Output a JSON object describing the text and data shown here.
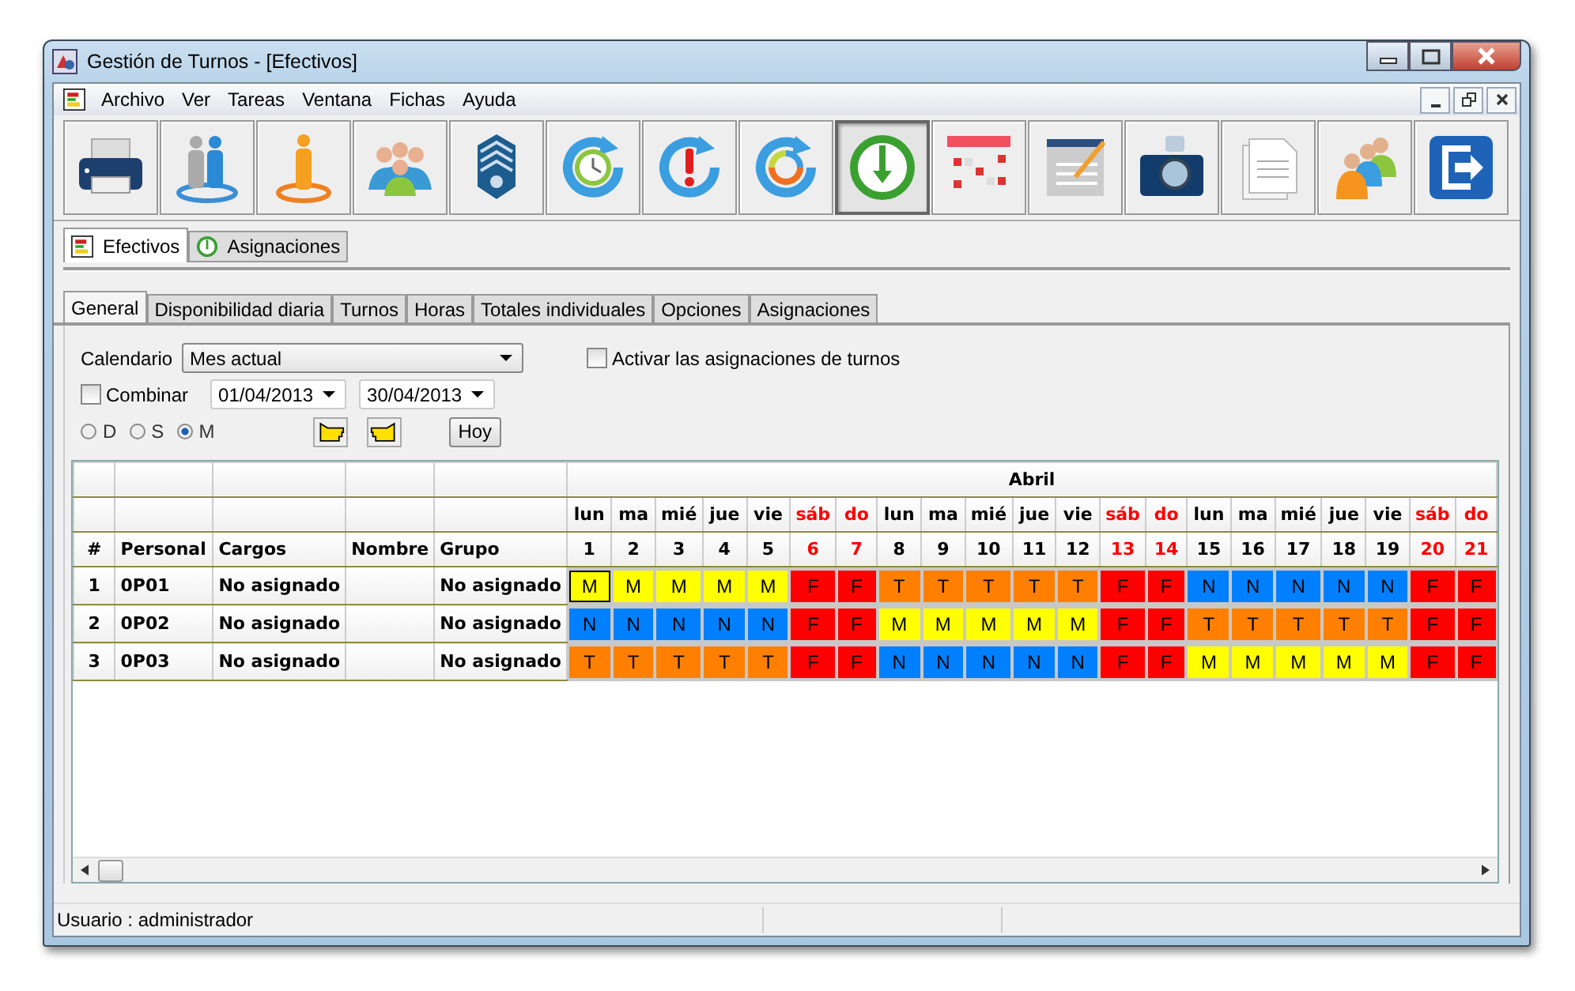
{
  "window": {
    "title": "Gestión de Turnos - [Efectivos]"
  },
  "menu": [
    "Archivo",
    "Ver",
    "Tareas",
    "Ventana",
    "Fichas",
    "Ayuda"
  ],
  "toolbar": [
    {
      "kind": "printer",
      "selected": false
    },
    {
      "kind": "pair",
      "selected": false
    },
    {
      "kind": "person",
      "selected": false
    },
    {
      "kind": "group",
      "selected": false
    },
    {
      "kind": "badge",
      "selected": false
    },
    {
      "kind": "clockcycle",
      "selected": false
    },
    {
      "kind": "alertcycle",
      "selected": false
    },
    {
      "kind": "chartcycle",
      "selected": false
    },
    {
      "kind": "clock",
      "selected": true
    },
    {
      "kind": "calendar",
      "selected": false
    },
    {
      "kind": "notepad",
      "selected": false
    },
    {
      "kind": "camera",
      "selected": false
    },
    {
      "kind": "document",
      "selected": false
    },
    {
      "kind": "team",
      "selected": false
    },
    {
      "kind": "exit",
      "selected": false
    }
  ],
  "doc_tabs": [
    {
      "label": "Efectivos",
      "kind": "grid",
      "selected": true
    },
    {
      "label": "Asignaciones",
      "kind": "clock",
      "selected": false
    }
  ],
  "tabs": [
    {
      "label": "General",
      "selected": true
    },
    {
      "label": "Disponibilidad diaria",
      "selected": false
    },
    {
      "label": "Turnos",
      "selected": false
    },
    {
      "label": "Horas",
      "selected": false
    },
    {
      "label": "Totales individuales",
      "selected": false
    },
    {
      "label": "Opciones",
      "selected": false
    },
    {
      "label": "Asignaciones",
      "selected": false
    }
  ],
  "form": {
    "calendar_label": "Calendario",
    "calendar_value": "Mes actual",
    "activate": {
      "label": "Activar las asignaciones de turnos",
      "checked": false
    },
    "combine": {
      "label": "Combinar",
      "checked": false
    },
    "date_from": "01/04/2013",
    "date_to": "30/04/2013",
    "radios": [
      {
        "label": "D",
        "selected": false
      },
      {
        "label": "S",
        "selected": false
      },
      {
        "label": "M",
        "selected": true
      }
    ],
    "today_button": "Hoy"
  },
  "grid": {
    "month": "Abril",
    "columns": [
      "#",
      "Personal",
      "Cargos",
      "Nombre",
      "Grupo"
    ],
    "days": [
      {
        "weekday": "lun",
        "day": "1",
        "weekend": false
      },
      {
        "weekday": "ma",
        "day": "2",
        "weekend": false
      },
      {
        "weekday": "mié",
        "day": "3",
        "weekend": false
      },
      {
        "weekday": "jue",
        "day": "4",
        "weekend": false
      },
      {
        "weekday": "vie",
        "day": "5",
        "weekend": false
      },
      {
        "weekday": "sáb",
        "day": "6",
        "weekend": true
      },
      {
        "weekday": "do",
        "day": "7",
        "weekend": true
      },
      {
        "weekday": "lun",
        "day": "8",
        "weekend": false
      },
      {
        "weekday": "ma",
        "day": "9",
        "weekend": false
      },
      {
        "weekday": "mié",
        "day": "10",
        "weekend": false
      },
      {
        "weekday": "jue",
        "day": "11",
        "weekend": false
      },
      {
        "weekday": "vie",
        "day": "12",
        "weekend": false
      },
      {
        "weekday": "sáb",
        "day": "13",
        "weekend": true
      },
      {
        "weekday": "do",
        "day": "14",
        "weekend": true
      },
      {
        "weekday": "lun",
        "day": "15",
        "weekend": false
      },
      {
        "weekday": "ma",
        "day": "16",
        "weekend": false
      },
      {
        "weekday": "mié",
        "day": "17",
        "weekend": false
      },
      {
        "weekday": "jue",
        "day": "18",
        "weekend": false
      },
      {
        "weekday": "vie",
        "day": "19",
        "weekend": false
      },
      {
        "weekday": "sáb",
        "day": "20",
        "weekend": true
      },
      {
        "weekday": "do",
        "day": "21",
        "weekend": true
      }
    ],
    "rows": [
      {
        "num": "1",
        "personal": "0P01",
        "cargos": "No asignado",
        "grupo": "No asignado",
        "shifts": [
          {
            "code": "M",
            "color": "#ffff00",
            "selected": true
          },
          {
            "code": "M",
            "color": "#ffff00",
            "selected": false
          },
          {
            "code": "M",
            "color": "#ffff00",
            "selected": false
          },
          {
            "code": "M",
            "color": "#ffff00",
            "selected": false
          },
          {
            "code": "M",
            "color": "#ffff00",
            "selected": false
          },
          {
            "code": "F",
            "color": "#ff0000",
            "selected": false
          },
          {
            "code": "F",
            "color": "#ff0000",
            "selected": false
          },
          {
            "code": "T",
            "color": "#ff8000",
            "selected": false
          },
          {
            "code": "T",
            "color": "#ff8000",
            "selected": false
          },
          {
            "code": "T",
            "color": "#ff8000",
            "selected": false
          },
          {
            "code": "T",
            "color": "#ff8000",
            "selected": false
          },
          {
            "code": "T",
            "color": "#ff8000",
            "selected": false
          },
          {
            "code": "F",
            "color": "#ff0000",
            "selected": false
          },
          {
            "code": "F",
            "color": "#ff0000",
            "selected": false
          },
          {
            "code": "N",
            "color": "#0080ff",
            "selected": false
          },
          {
            "code": "N",
            "color": "#0080ff",
            "selected": false
          },
          {
            "code": "N",
            "color": "#0080ff",
            "selected": false
          },
          {
            "code": "N",
            "color": "#0080ff",
            "selected": false
          },
          {
            "code": "N",
            "color": "#0080ff",
            "selected": false
          },
          {
            "code": "F",
            "color": "#ff0000",
            "selected": false
          },
          {
            "code": "F",
            "color": "#ff0000",
            "selected": false
          }
        ]
      },
      {
        "num": "2",
        "personal": "0P02",
        "cargos": "No asignado",
        "grupo": "No asignado",
        "shifts": [
          {
            "code": "N",
            "color": "#0080ff",
            "selected": false
          },
          {
            "code": "N",
            "color": "#0080ff",
            "selected": false
          },
          {
            "code": "N",
            "color": "#0080ff",
            "selected": false
          },
          {
            "code": "N",
            "color": "#0080ff",
            "selected": false
          },
          {
            "code": "N",
            "color": "#0080ff",
            "selected": false
          },
          {
            "code": "F",
            "color": "#ff0000",
            "selected": false
          },
          {
            "code": "F",
            "color": "#ff0000",
            "selected": false
          },
          {
            "code": "M",
            "color": "#ffff00",
            "selected": false
          },
          {
            "code": "M",
            "color": "#ffff00",
            "selected": false
          },
          {
            "code": "M",
            "color": "#ffff00",
            "selected": false
          },
          {
            "code": "M",
            "color": "#ffff00",
            "selected": false
          },
          {
            "code": "M",
            "color": "#ffff00",
            "selected": false
          },
          {
            "code": "F",
            "color": "#ff0000",
            "selected": false
          },
          {
            "code": "F",
            "color": "#ff0000",
            "selected": false
          },
          {
            "code": "T",
            "color": "#ff8000",
            "selected": false
          },
          {
            "code": "T",
            "color": "#ff8000",
            "selected": false
          },
          {
            "code": "T",
            "color": "#ff8000",
            "selected": false
          },
          {
            "code": "T",
            "color": "#ff8000",
            "selected": false
          },
          {
            "code": "T",
            "color": "#ff8000",
            "selected": false
          },
          {
            "code": "F",
            "color": "#ff0000",
            "selected": false
          },
          {
            "code": "F",
            "color": "#ff0000",
            "selected": false
          }
        ]
      },
      {
        "num": "3",
        "personal": "0P03",
        "cargos": "No asignado",
        "grupo": "No asignado",
        "shifts": [
          {
            "code": "T",
            "color": "#ff8000",
            "selected": false
          },
          {
            "code": "T",
            "color": "#ff8000",
            "selected": false
          },
          {
            "code": "T",
            "color": "#ff8000",
            "selected": false
          },
          {
            "code": "T",
            "color": "#ff8000",
            "selected": false
          },
          {
            "code": "T",
            "color": "#ff8000",
            "selected": false
          },
          {
            "code": "F",
            "color": "#ff0000",
            "selected": false
          },
          {
            "code": "F",
            "color": "#ff0000",
            "selected": false
          },
          {
            "code": "N",
            "color": "#0080ff",
            "selected": false
          },
          {
            "code": "N",
            "color": "#0080ff",
            "selected": false
          },
          {
            "code": "N",
            "color": "#0080ff",
            "selected": false
          },
          {
            "code": "N",
            "color": "#0080ff",
            "selected": false
          },
          {
            "code": "N",
            "color": "#0080ff",
            "selected": false
          },
          {
            "code": "F",
            "color": "#ff0000",
            "selected": false
          },
          {
            "code": "F",
            "color": "#ff0000",
            "selected": false
          },
          {
            "code": "M",
            "color": "#ffff00",
            "selected": false
          },
          {
            "code": "M",
            "color": "#ffff00",
            "selected": false
          },
          {
            "code": "M",
            "color": "#ffff00",
            "selected": false
          },
          {
            "code": "M",
            "color": "#ffff00",
            "selected": false
          },
          {
            "code": "M",
            "color": "#ffff00",
            "selected": false
          },
          {
            "code": "F",
            "color": "#ff0000",
            "selected": false
          },
          {
            "code": "F",
            "color": "#ff0000",
            "selected": false
          }
        ]
      }
    ]
  },
  "status_bar": "Usuario : administrador"
}
